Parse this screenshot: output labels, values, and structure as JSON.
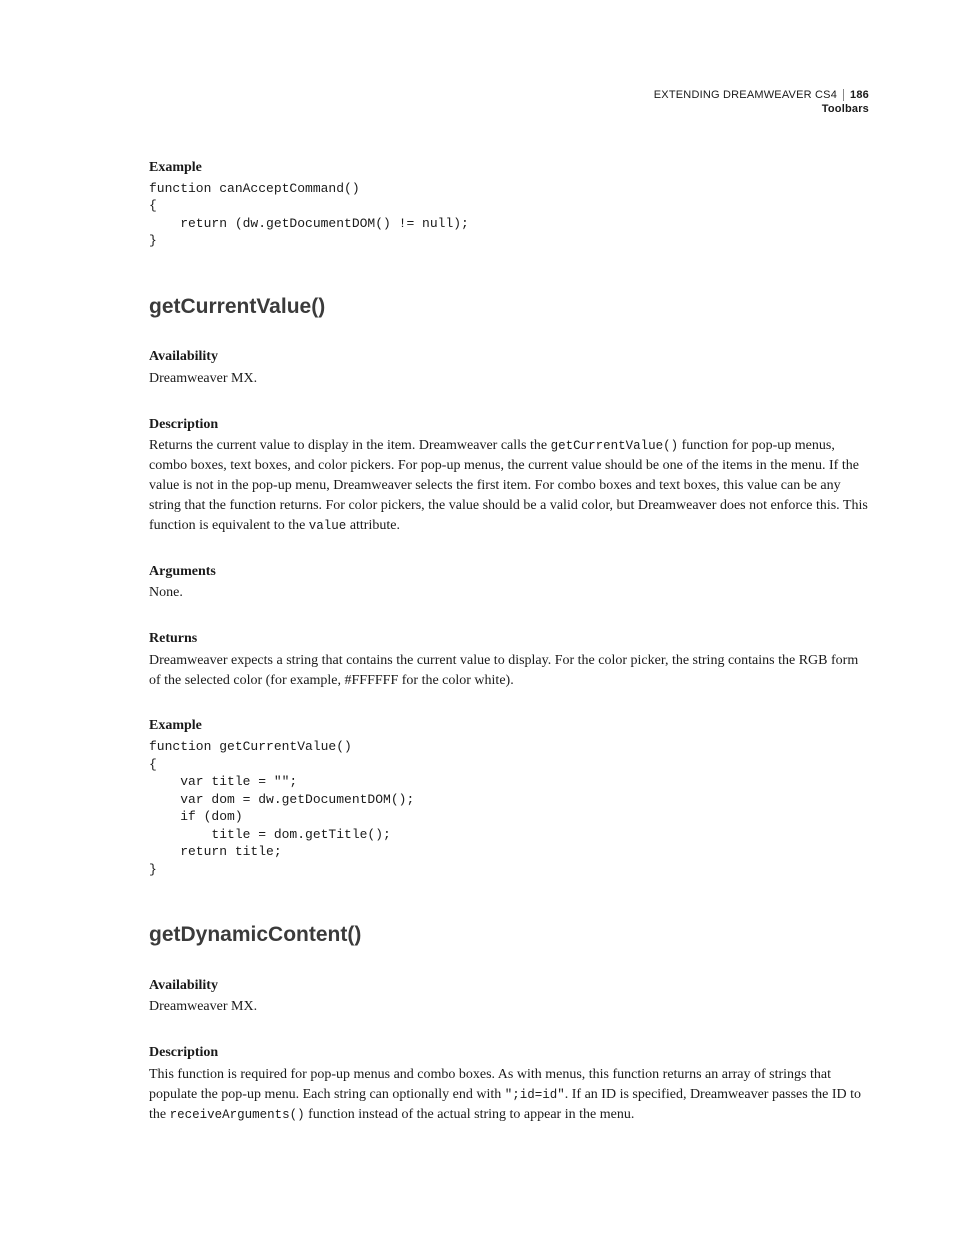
{
  "header": {
    "doc_title": "EXTENDING DREAMWEAVER CS4",
    "section": "Toolbars",
    "page": "186"
  },
  "block1": {
    "example_label": "Example",
    "code": "function canAcceptCommand()\n{\n    return (dw.getDocumentDOM() != null);\n}"
  },
  "sec1": {
    "title": "getCurrentValue()",
    "avail_label": "Availability",
    "avail_text": "Dreamweaver MX.",
    "desc_label": "Description",
    "desc_pre": "Returns the current value to display in the item. Dreamweaver calls the ",
    "desc_code1": "getCurrentValue()",
    "desc_mid": " function for pop-up menus, combo boxes, text boxes, and color pickers. For pop-up menus, the current value should be one of the items in the menu. If the value is not in the pop-up menu, Dreamweaver selects the first item. For combo boxes and text boxes, this value can be any string that the function returns. For color pickers, the value should be a valid color, but Dreamweaver does not enforce this. This function is equivalent to the ",
    "desc_code2": "value",
    "desc_post": " attribute.",
    "args_label": "Arguments",
    "args_text": "None.",
    "ret_label": "Returns",
    "ret_text": "Dreamweaver expects a string that contains the current value to display. For the color picker, the string contains the RGB form of the selected color (for example, #FFFFFF for the color white).",
    "example_label": "Example",
    "example_code": "function getCurrentValue()\n{\n    var title = \"\";\n    var dom = dw.getDocumentDOM();\n    if (dom)\n        title = dom.getTitle();\n    return title;\n}"
  },
  "sec2": {
    "title": "getDynamicContent()",
    "avail_label": "Availability",
    "avail_text": "Dreamweaver MX.",
    "desc_label": "Description",
    "desc_pre": "This function is required for pop-up menus and combo boxes. As with menus, this function returns an array of strings that populate the pop-up menu. Each string can optionally end with ",
    "desc_code1": "\";id=id\"",
    "desc_mid": ". If an ID is specified, Dreamweaver passes the ID to the ",
    "desc_code2": "receiveArguments()",
    "desc_post": " function instead of the actual string to appear in the menu."
  }
}
